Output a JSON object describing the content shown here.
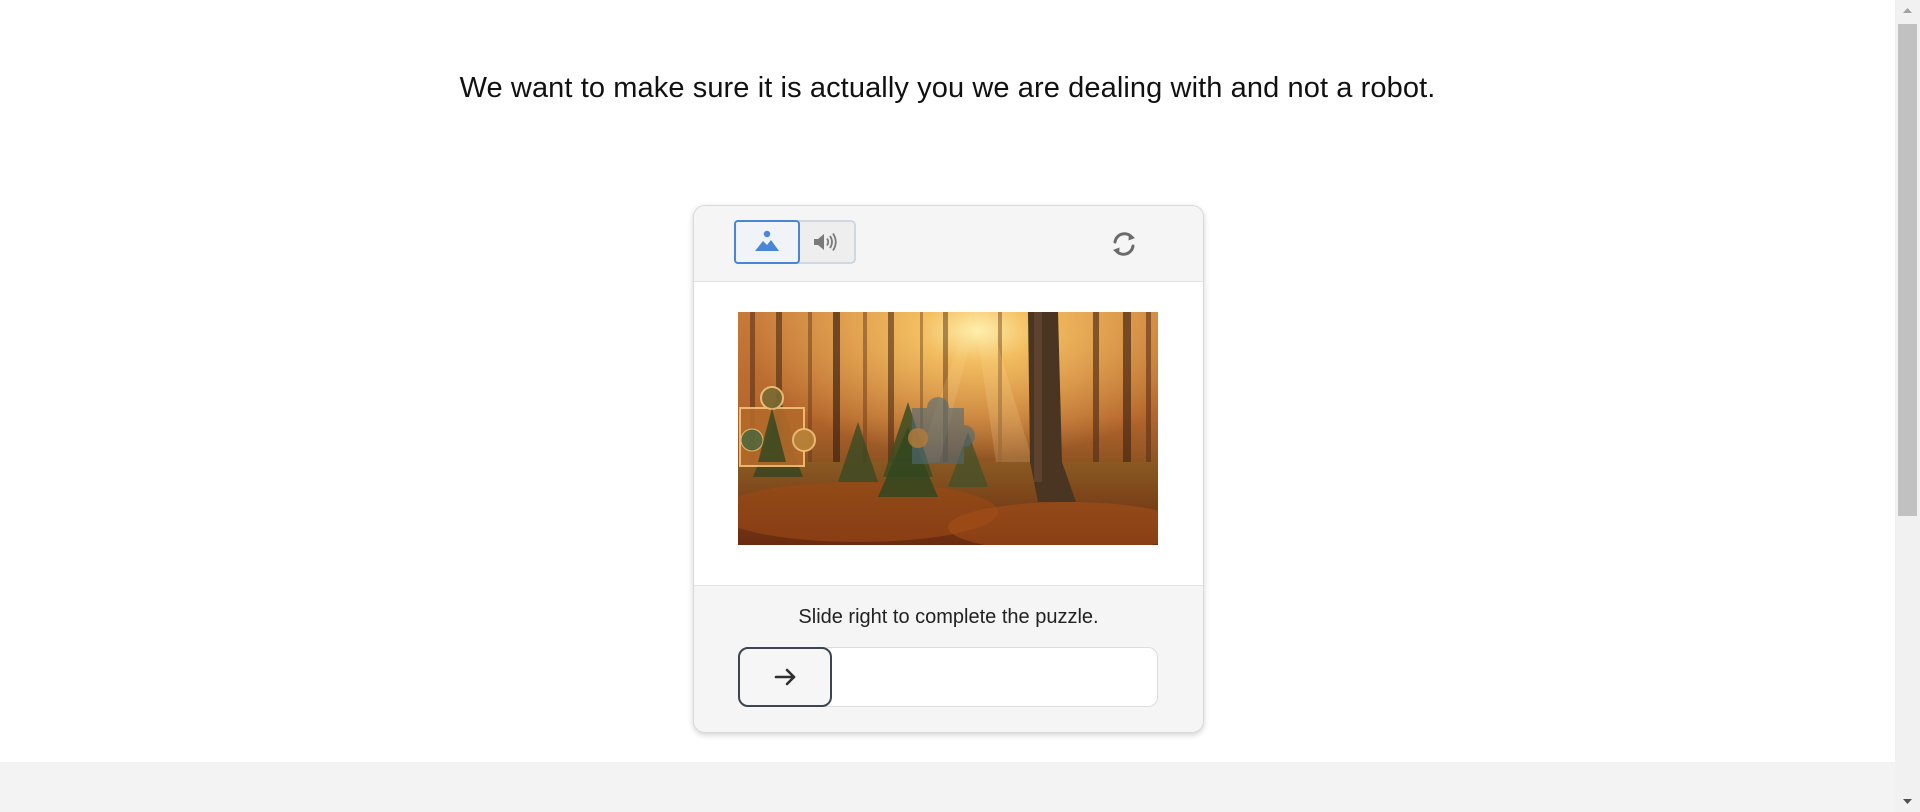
{
  "heading": "We want to make sure it is actually you we are dealing with and not a robot.",
  "captcha": {
    "modes": [
      {
        "name": "image",
        "icon": "image-icon",
        "selected": true
      },
      {
        "name": "audio",
        "icon": "speaker-icon",
        "selected": false
      }
    ],
    "refresh_icon": "refresh-icon",
    "instruction": "Slide right to complete the puzzle.",
    "slider": {
      "handle_icon": "arrow-right-icon",
      "progress": 0
    }
  },
  "colors": {
    "accent": "#4a86d8",
    "handle_border": "#3b4652",
    "panel_background": "#f5f5f5"
  }
}
